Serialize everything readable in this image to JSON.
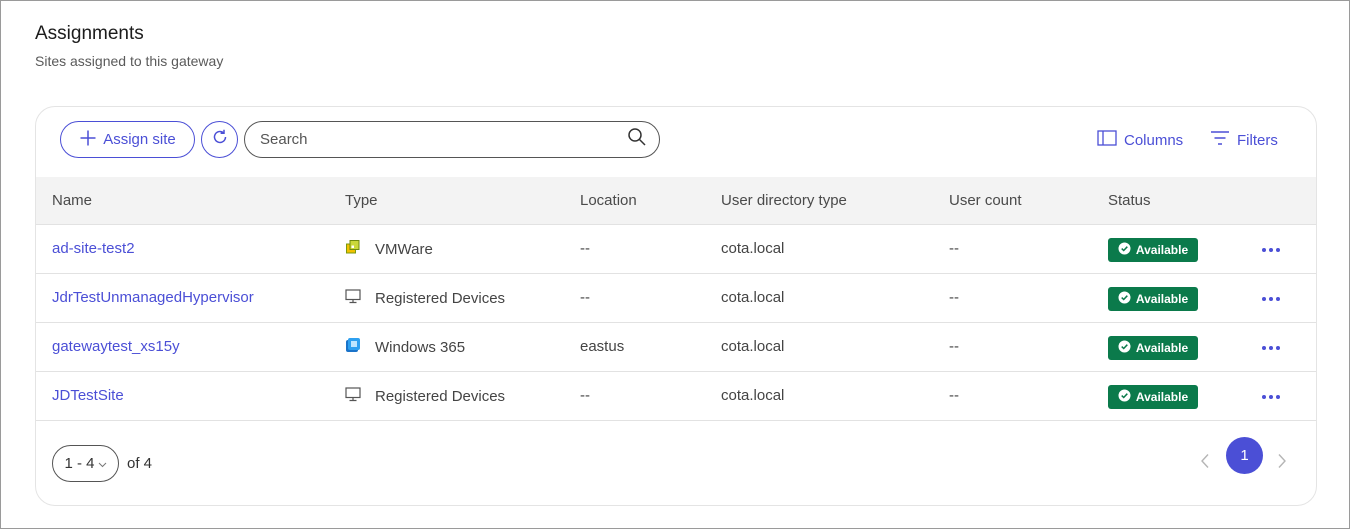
{
  "header": {
    "title": "Assignments",
    "subtitle": "Sites assigned to this gateway"
  },
  "toolbar": {
    "assign_label": "Assign site",
    "search_placeholder": "Search",
    "columns_label": "Columns",
    "filters_label": "Filters"
  },
  "table": {
    "columns": [
      "Name",
      "Type",
      "Location",
      "User directory type",
      "User count",
      "Status"
    ],
    "rows": [
      {
        "name": "ad-site-test2",
        "type": "VMWare",
        "type_icon": "vmware-icon",
        "location": "--",
        "directory": "cota.local",
        "user_count": "--",
        "status": "Available"
      },
      {
        "name": "JdrTestUnmanagedHypervisor",
        "type": "Registered Devices",
        "type_icon": "monitor-icon",
        "location": "--",
        "directory": "cota.local",
        "user_count": "--",
        "status": "Available"
      },
      {
        "name": "gatewaytest_xs15y",
        "type": "Windows 365",
        "type_icon": "windows365-icon",
        "location": "eastus",
        "directory": "cota.local",
        "user_count": "--",
        "status": "Available"
      },
      {
        "name": "JDTestSite",
        "type": "Registered Devices",
        "type_icon": "monitor-icon",
        "location": "--",
        "directory": "cota.local",
        "user_count": "--",
        "status": "Available"
      }
    ]
  },
  "pagination": {
    "range": "1 - 4",
    "of_text": "of 4",
    "current_page": "1"
  },
  "colors": {
    "accent": "#4b4fd6",
    "status_available": "#0b7a4b"
  }
}
